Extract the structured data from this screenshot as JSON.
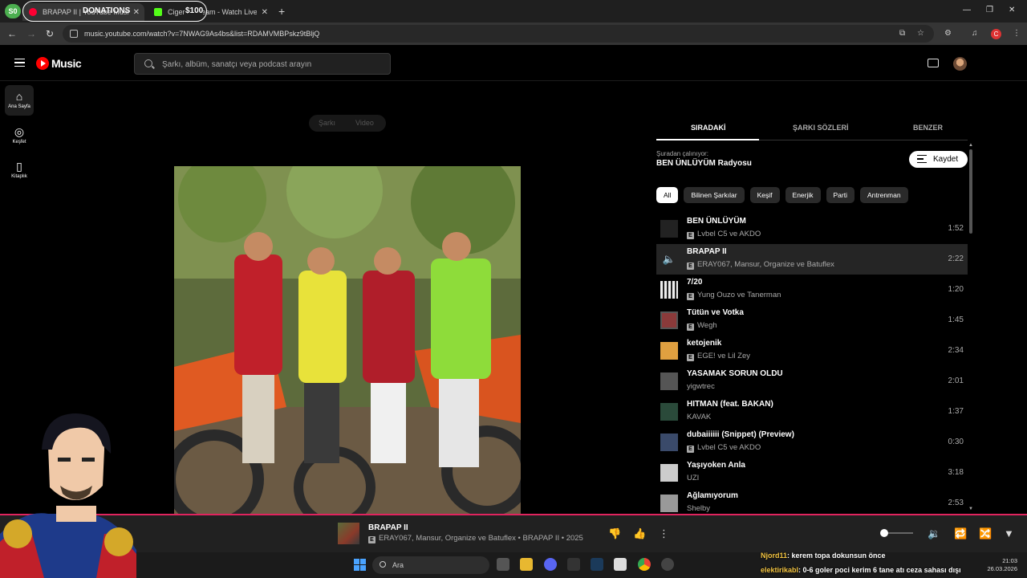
{
  "browser": {
    "profile_initials": "S0",
    "tabs": [
      {
        "title": "BRAPAP II | YouTube Music",
        "favicon_color": "#ff0033"
      },
      {
        "title": "Cigerci Stream - Watch Live on Kick",
        "favicon_color": "#53fc18"
      }
    ],
    "overlay_donations": "DONATIONS",
    "overlay_amount": "$100",
    "url": "music.youtube.com/watch?v=7NWAG9As4bs&list=RDAMVMBPskz9tBljQ",
    "profile_letter": "C"
  },
  "header": {
    "logo_text": "Music",
    "search_placeholder": "Şarkı, albüm, sanatçı veya podcast arayın"
  },
  "left_nav": [
    {
      "label": "Ana Sayfa",
      "icon": "home-icon",
      "active": true
    },
    {
      "label": "Keşfet",
      "icon": "explore-icon",
      "active": false
    },
    {
      "label": "Kitaplık",
      "icon": "library-icon",
      "active": false
    }
  ],
  "player": {
    "toggle_song": "Şarkı",
    "toggle_video": "Video"
  },
  "right_panel": {
    "tabs": [
      "SIRADAKİ",
      "ŞARKI SÖZLERİ",
      "BENZER"
    ],
    "playing_from_label": "Şuradan çalınıyor:",
    "playing_from_title": "BEN ÜNLÜYÜM Radyosu",
    "save_label": "Kaydet",
    "chips": [
      "All",
      "Bilinen Şarkılar",
      "Keşif",
      "Enerjik",
      "Parti",
      "Antrenman"
    ]
  },
  "queue": [
    {
      "title": "BEN ÜNLÜYÜM",
      "artist": "Lvbel C5 ve AKDO",
      "duration": "1:52",
      "explicit": true,
      "playing": false,
      "thumb_color": "#222"
    },
    {
      "title": "BRAPAP II",
      "artist": "ERAY067, Mansur, Organize ve Batuflex",
      "duration": "2:22",
      "explicit": true,
      "playing": true,
      "thumb_color": "#252525"
    },
    {
      "title": "7/20",
      "artist": "Yung Ouzo ve Tanerman",
      "duration": "1:20",
      "explicit": true,
      "playing": false,
      "thumb_color": "#ddd"
    },
    {
      "title": "Tütün ve Votka",
      "artist": "Wegh",
      "duration": "1:45",
      "explicit": true,
      "playing": false,
      "thumb_color": "#8a3a3a"
    },
    {
      "title": "ketojenik",
      "artist": "EGE! ve Lil Zey",
      "duration": "2:34",
      "explicit": true,
      "playing": false,
      "thumb_color": "#e0a040"
    },
    {
      "title": "YASAMAK SORUN OLDU",
      "artist": "yigwtrec",
      "duration": "2:01",
      "explicit": false,
      "playing": false,
      "thumb_color": "#555"
    },
    {
      "title": "HITMAN (feat. BAKAN)",
      "artist": "KAVAK",
      "duration": "1:37",
      "explicit": false,
      "playing": false,
      "thumb_color": "#2a4a3a"
    },
    {
      "title": "dubaiiiiii (Snippet) (Preview)",
      "artist": "Lvbel C5 ve AKDO",
      "duration": "0:30",
      "explicit": true,
      "playing": false,
      "thumb_color": "#3a4a6a"
    },
    {
      "title": "Yaşıyoken Anla",
      "artist": "UZI",
      "duration": "3:18",
      "explicit": false,
      "playing": false,
      "thumb_color": "#ccc"
    },
    {
      "title": "Ağlamıyorum",
      "artist": "Shelby",
      "duration": "2:53",
      "explicit": false,
      "playing": false,
      "thumb_color": "#999"
    }
  ],
  "player_bar": {
    "title": "BRAPAP II",
    "subtitle": "ERAY067, Mansur, Organize ve Batuflex • BRAPAP II • 2025",
    "volume": 0.1
  },
  "taskbar": {
    "search_placeholder": "Ara",
    "time": "21:03",
    "date": "26.03.2026"
  },
  "chat": [
    {
      "user": "Njord11",
      "message": ": kerem topa dokunsun önce"
    },
    {
      "user": "elektirikabl",
      "message": ": 0-6 goler poci kerim 6 tane atı ceza sahası dışı"
    }
  ]
}
